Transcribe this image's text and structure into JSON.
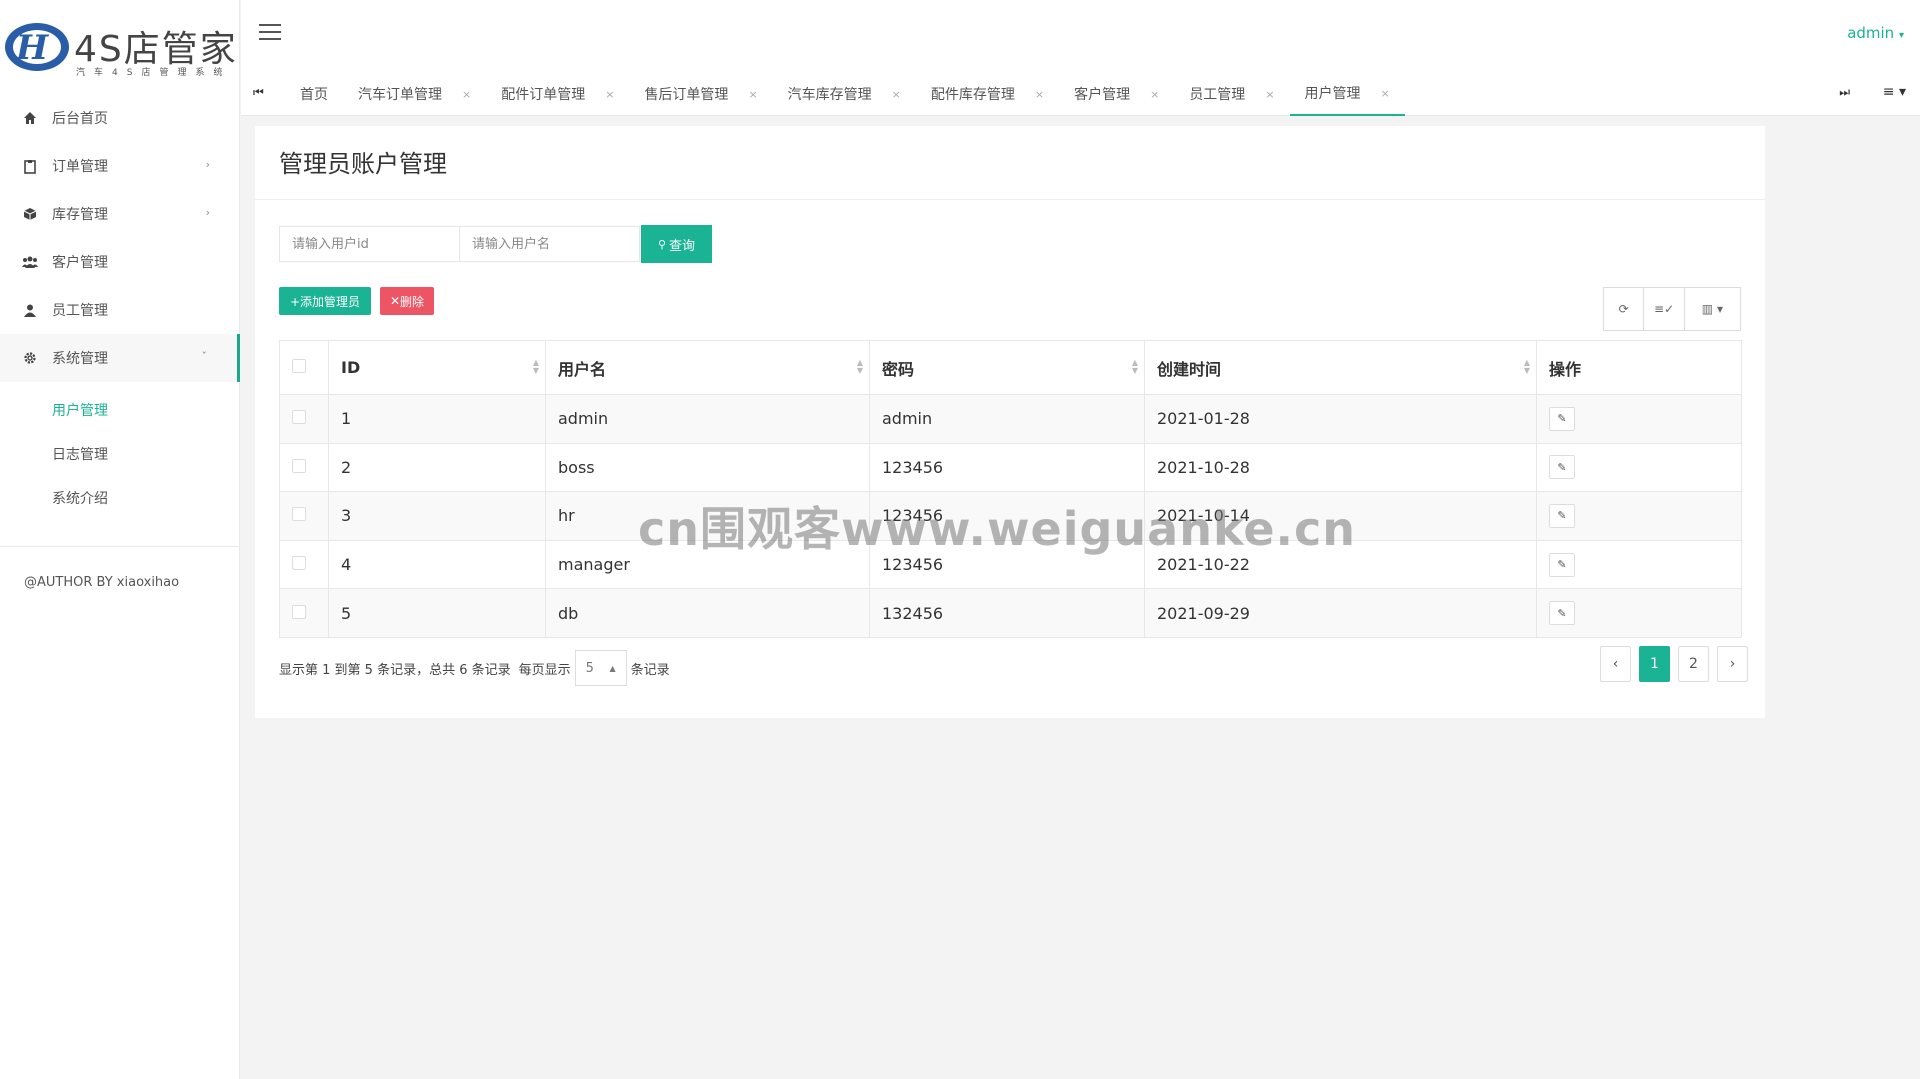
{
  "app": {
    "logo_title": "4S店管家",
    "logo_subtitle": "汽车4S店管理系统"
  },
  "sidebar": {
    "items": [
      {
        "label": "后台首页",
        "icon": "home-icon"
      },
      {
        "label": "订单管理",
        "icon": "clipboard-icon"
      },
      {
        "label": "库存管理",
        "icon": "cube-icon"
      },
      {
        "label": "客户管理",
        "icon": "users-icon"
      },
      {
        "label": "员工管理",
        "icon": "user-icon"
      },
      {
        "label": "系统管理",
        "icon": "gear-icon"
      }
    ],
    "subitems": [
      {
        "label": "用户管理"
      },
      {
        "label": "日志管理"
      },
      {
        "label": "系统介绍"
      }
    ],
    "author": "@AUTHOR BY xiaoxihao"
  },
  "header": {
    "user": "admin"
  },
  "tabs": [
    {
      "label": "首页"
    },
    {
      "label": "汽车订单管理"
    },
    {
      "label": "配件订单管理"
    },
    {
      "label": "售后订单管理"
    },
    {
      "label": "汽车库存管理"
    },
    {
      "label": "配件库存管理"
    },
    {
      "label": "客户管理"
    },
    {
      "label": "员工管理"
    },
    {
      "label": "用户管理"
    }
  ],
  "main": {
    "title": "管理员账户管理",
    "search": {
      "id_placeholder": "请输入用户id",
      "name_placeholder": "请输入用户名",
      "button": "查询"
    },
    "actions": {
      "add": "+添加管理员",
      "delete": "删除"
    },
    "table": {
      "headers": [
        "ID",
        "用户名",
        "密码",
        "创建时间",
        "操作"
      ],
      "rows": [
        {
          "id": "1",
          "username": "admin",
          "password": "admin",
          "created": "2021-01-28"
        },
        {
          "id": "2",
          "username": "boss",
          "password": "123456",
          "created": "2021-10-28"
        },
        {
          "id": "3",
          "username": "hr",
          "password": "123456",
          "created": "2021-10-14"
        },
        {
          "id": "4",
          "username": "manager",
          "password": "123456",
          "created": "2021-10-22"
        },
        {
          "id": "5",
          "username": "db",
          "password": "132456",
          "created": "2021-09-29"
        }
      ]
    },
    "pagination": {
      "info": "显示第 1 到第 5 条记录，总共 6 条记录",
      "per_page_prefix": "每页显示",
      "per_page_value": "5",
      "per_page_suffix": "条记录",
      "prev": "‹",
      "pages": [
        "1",
        "2"
      ],
      "next": "›",
      "current": "1"
    }
  },
  "watermark": "cn围观客www.weiguanke.cn",
  "colors": {
    "accent": "#1ab394",
    "danger": "#ed5565"
  }
}
